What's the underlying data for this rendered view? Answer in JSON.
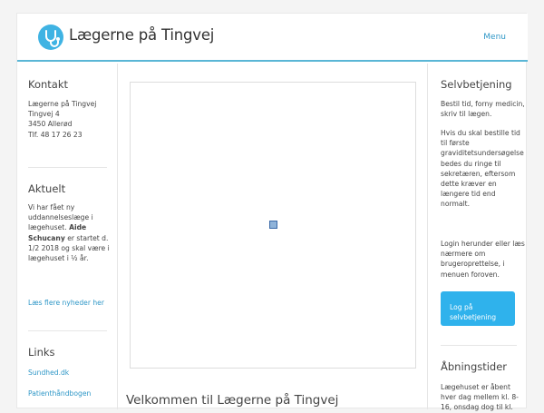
{
  "header": {
    "site_title": "Lægerne på Tingvej",
    "menu_label": "Menu"
  },
  "sidebar_left": {
    "contact": {
      "title": "Kontakt",
      "lines": [
        "Lægerne på Tingvej",
        "Tingvej 4",
        "3450 Allerød",
        "Tlf. 48 17 26 23"
      ]
    },
    "news": {
      "title": "Aktuelt",
      "text_lines": [
        "Vi har fået ny",
        "uddannelseslæge i",
        "lægehuset."
      ],
      "name_part1": "Aide",
      "name_part2": "Schucany",
      "text_after_name_1": "er startet d.",
      "text_after_name_2": "1/2 2018 og skal være i",
      "text_after_name_3": "lægehuset i ½ år.",
      "more_link": "Læs flere nyheder her"
    },
    "links": {
      "title": "Links",
      "items": [
        "Sundhed.dk",
        "Patienthåndbogen"
      ]
    }
  },
  "main": {
    "welcome_heading": "Velkommen til Lægerne på Tingvej"
  },
  "sidebar_right": {
    "selfservice": {
      "title": "Selvbetjening",
      "intro_lines": [
        "Bestil tid, forny medicin,",
        "skriv til lægen."
      ],
      "pregnancy_lines": [
        "Hvis du skal bestille tid",
        "til første",
        "graviditetsundersøgelse",
        "bedes du ringe til",
        "sekretæren, eftersom",
        "dette kræver en",
        "længere tid end",
        "normalt."
      ],
      "login_lines": [
        "Login herunder eller læs",
        "nærmere om",
        "brugeroprettelse, i",
        "menuen foroven."
      ],
      "button_lines": [
        "Log på",
        "selvbetjening"
      ]
    },
    "hours": {
      "title": "Åbningstider",
      "lines": [
        "Lægehuset er åbent",
        "hver dag mellem kl. 8-",
        "16, onsdag dog til kl."
      ]
    }
  },
  "colors": {
    "accent": "#2fb2ec",
    "link": "#2f97c7",
    "header_border": "#5ab6d6"
  },
  "icons": {
    "logo": "stethoscope-icon",
    "image_placeholder": "broken-image-icon"
  }
}
